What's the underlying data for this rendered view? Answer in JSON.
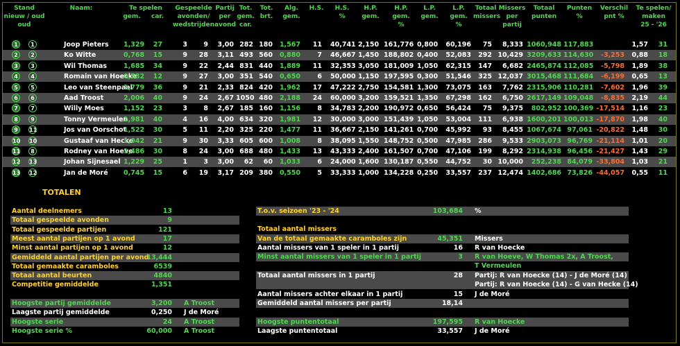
{
  "headers": {
    "stand": "Stand\nnieuw / oud\noud",
    "naam": "Naam:",
    "te_spelen": "Te spelen",
    "te_spelen_gem": "gem.",
    "te_spelen_car": "car.",
    "gespeelde": "Gespeelde\navonden/\nwedstrijden",
    "partij": "Partij\nper\navond",
    "tot_gem_car": "Tot.\ngem.\ncar.",
    "tot_brt": "Tot.\nbrt.",
    "alg_gem": "Alg.\ngem.",
    "hs": "H.S.",
    "hs_pct": "H.S.\n%",
    "hp_gem": "H.P.\ngem.",
    "hp_pct": "H.P.\ngem.\n%",
    "lp_gem": "L.P.\ngem.",
    "lp_pct": "L.P.\ngem.\n%",
    "totaal_missers": "Totaal\nmissers",
    "missers_per_partij": "Missers\nper\npartij",
    "totaal_punten": "Totaal\npunten",
    "punten_pct": "Punten\n%",
    "verschil": "Verschil\npnt %",
    "te_spelen_maken": "Te spelen/\nmaken\n25 - '26"
  },
  "players": [
    {
      "nieuw": "1",
      "oud": "1",
      "naam": "Joop Pieters",
      "gem": "1,329",
      "car": "27",
      "av": "3",
      "wed": "9",
      "ppa": "3,00",
      "totcar": "282",
      "brt": "180",
      "alg": "1,567",
      "hs": "11",
      "hspct": "40,741",
      "hpgem": "2,150",
      "hppct": "161,776",
      "lpgem": "0,800",
      "lppct": "60,196",
      "miss": "75",
      "mpp": "8,333",
      "punten": "1060,948",
      "pct": "117,883",
      "versch": "",
      "ts1": "1,57",
      "ts2": "31"
    },
    {
      "nieuw": "2",
      "oud": "2",
      "naam": "Ko Witte",
      "gem": "0,768",
      "car": "15",
      "av": "9",
      "wed": "28",
      "ppa": "3,11",
      "totcar": "493",
      "brt": "560",
      "alg": "0,880",
      "hs": "7",
      "hspct": "46,667",
      "hpgem": "1,450",
      "hppct": "188,802",
      "lpgem": "0,400",
      "lppct": "52,083",
      "miss": "292",
      "mpp": "10,429",
      "punten": "3209,633",
      "pct": "114,630",
      "versch": "-3,253",
      "ts1": "0,88",
      "ts2": "18"
    },
    {
      "nieuw": "3",
      "oud": "3",
      "naam": "Wil Thomas",
      "gem": "1,685",
      "car": "34",
      "av": "9",
      "wed": "22",
      "ppa": "2,44",
      "totcar": "831",
      "brt": "440",
      "alg": "1,889",
      "hs": "11",
      "hspct": "32,353",
      "hpgem": "3,050",
      "hppct": "181,009",
      "lpgem": "1,050",
      "lppct": "62,315",
      "miss": "147",
      "mpp": "6,682",
      "punten": "2465,874",
      "pct": "112,085",
      "versch": "-5,798",
      "ts1": "1,89",
      "ts2": "38"
    },
    {
      "nieuw": "4",
      "oud": "4",
      "naam": "Romain van Hoecke",
      "gem": "0,582",
      "car": "12",
      "av": "9",
      "wed": "27",
      "ppa": "3,00",
      "totcar": "351",
      "brt": "540",
      "alg": "0,650",
      "hs": "6",
      "hspct": "50,000",
      "hpgem": "1,150",
      "hppct": "197,595",
      "lpgem": "0,300",
      "lppct": "51,546",
      "miss": "325",
      "mpp": "12,037",
      "punten": "3015,468",
      "pct": "111,684",
      "versch": "-6,199",
      "ts1": "0,65",
      "ts2": "13"
    },
    {
      "nieuw": "5",
      "oud": "5",
      "naam": "Leo van Steenpaal",
      "gem": "1,779",
      "car": "36",
      "av": "9",
      "wed": "21",
      "ppa": "2,33",
      "totcar": "824",
      "brt": "420",
      "alg": "1,962",
      "hs": "17",
      "hspct": "47,222",
      "hpgem": "2,750",
      "hppct": "154,581",
      "lpgem": "1,300",
      "lppct": "73,075",
      "miss": "163",
      "mpp": "7,762",
      "punten": "2315,906",
      "pct": "110,281",
      "versch": "-7,602",
      "ts1": "1,96",
      "ts2": "39"
    },
    {
      "nieuw": "6",
      "oud": "6",
      "naam": "Aad Troost",
      "gem": "2,006",
      "car": "40",
      "av": "9",
      "wed": "24",
      "ppa": "2,67",
      "totcar": "1050",
      "brt": "480",
      "alg": "2,188",
      "hs": "24",
      "hspct": "60,000",
      "hpgem": "3,200",
      "hppct": "159,521",
      "lpgem": "1,350",
      "lppct": "67,298",
      "miss": "162",
      "mpp": "6,750",
      "punten": "2617,149",
      "pct": "109,048",
      "versch": "-8,835",
      "ts1": "2,19",
      "ts2": "44"
    },
    {
      "nieuw": "7",
      "oud": "7",
      "naam": "Willy Moes",
      "gem": "1,152",
      "car": "23",
      "av": "3",
      "wed": "8",
      "ppa": "2,67",
      "totcar": "185",
      "brt": "160",
      "alg": "1,156",
      "hs": "8",
      "hspct": "34,783",
      "hpgem": "2,200",
      "hppct": "190,972",
      "lpgem": "0,650",
      "lppct": "56,424",
      "miss": "75",
      "mpp": "9,375",
      "punten": "802,952",
      "pct": "100,369",
      "versch": "-17,514",
      "ts1": "1,16",
      "ts2": "23"
    },
    {
      "nieuw": "8",
      "oud": "9",
      "naam": "Tonny Vermeulen",
      "gem": "1,981",
      "car": "40",
      "av": "4",
      "wed": "16",
      "ppa": "4,00",
      "totcar": "634",
      "brt": "320",
      "alg": "1,981",
      "hs": "12",
      "hspct": "30,000",
      "hpgem": "3,000",
      "hppct": "151,439",
      "lpgem": "1,050",
      "lppct": "53,004",
      "miss": "111",
      "mpp": "6,938",
      "punten": "1600,201",
      "pct": "100,013",
      "versch": "-17,870",
      "ts1": "1,98",
      "ts2": "40"
    },
    {
      "nieuw": "9",
      "oud": "11",
      "naam": "Jos van Oorschot",
      "gem": "1,522",
      "car": "30",
      "av": "5",
      "wed": "11",
      "ppa": "2,20",
      "totcar": "325",
      "brt": "220",
      "alg": "1,477",
      "hs": "11",
      "hspct": "36,667",
      "hpgem": "2,150",
      "hppct": "141,261",
      "lpgem": "0,700",
      "lppct": "45,992",
      "miss": "93",
      "mpp": "8,455",
      "punten": "1067,674",
      "pct": "97,061",
      "versch": "-20,822",
      "ts1": "1,48",
      "ts2": "30"
    },
    {
      "nieuw": "10",
      "oud": "10",
      "naam": "Gustaaf van Hecke",
      "gem": "1,042",
      "car": "21",
      "av": "9",
      "wed": "30",
      "ppa": "3,33",
      "totcar": "605",
      "brt": "600",
      "alg": "1,008",
      "hs": "8",
      "hspct": "38,095",
      "hpgem": "1,550",
      "hppct": "148,752",
      "lpgem": "0,500",
      "lppct": "47,985",
      "miss": "286",
      "mpp": "9,533",
      "punten": "2903,073",
      "pct": "96,769",
      "versch": "-21,114",
      "ts1": "1,01",
      "ts2": "20"
    },
    {
      "nieuw": "11",
      "oud": "8",
      "naam": "Rodney van Hoeve",
      "gem": "1,486",
      "car": "30",
      "av": "8",
      "wed": "24",
      "ppa": "3,00",
      "totcar": "688",
      "brt": "480",
      "alg": "1,433",
      "hs": "13",
      "hspct": "43,333",
      "hpgem": "2,400",
      "hppct": "161,507",
      "lpgem": "0,700",
      "lppct": "47,106",
      "miss": "199",
      "mpp": "8,292",
      "punten": "2314,938",
      "pct": "96,456",
      "versch": "-21,427",
      "ts1": "1,43",
      "ts2": "29"
    },
    {
      "nieuw": "12",
      "oud": "13",
      "naam": "Johan Sijnesael",
      "gem": "1,229",
      "car": "25",
      "av": "1",
      "wed": "3",
      "ppa": "3,00",
      "totcar": "62",
      "brt": "60",
      "alg": "1,033",
      "hs": "6",
      "hspct": "24,000",
      "hpgem": "1,600",
      "hppct": "130,187",
      "lpgem": "0,550",
      "lppct": "44,752",
      "miss": "30",
      "mpp": "10,000",
      "punten": "252,238",
      "pct": "84,079",
      "versch": "-33,804",
      "ts1": "1,03",
      "ts2": "21"
    },
    {
      "nieuw": "13",
      "oud": "12",
      "naam": "Jan de Moré",
      "gem": "0,745",
      "car": "15",
      "av": "6",
      "wed": "19",
      "ppa": "3,17",
      "totcar": "209",
      "brt": "380",
      "alg": "0,550",
      "hs": "5",
      "hspct": "33,333",
      "hpgem": "1,000",
      "hppct": "134,228",
      "lpgem": "0,250",
      "lppct": "33,557",
      "miss": "237",
      "mpp": "12,474",
      "punten": "1402,686",
      "pct": "73,826",
      "versch": "-44,057",
      "ts1": "0,55",
      "ts2": "11"
    }
  ],
  "totalen_title": "TOTALEN",
  "left_totals": [
    {
      "label": "Aantal deelnemers",
      "value": "13",
      "extra": "",
      "alt": false,
      "lc": "y"
    },
    {
      "label": "Totaal gespeelde avonden",
      "value": "9",
      "extra": "",
      "alt": true,
      "lc": "y"
    },
    {
      "label": "Totaal gespeelde partijen",
      "value": "121",
      "extra": "",
      "alt": false,
      "lc": "y"
    },
    {
      "label": "Meest aantal partijen op 1 avond",
      "value": "17",
      "extra": "",
      "alt": true,
      "lc": "y"
    },
    {
      "label": "Minst aantal partijen op 1 avond",
      "value": "12",
      "extra": "",
      "alt": false,
      "lc": "y"
    },
    {
      "label": "Gemiddeld aantal partijen per avond",
      "value": "13,444",
      "extra": "",
      "alt": true,
      "lc": "y"
    },
    {
      "label": "Totaal gemaakte caramboles",
      "value": "6539",
      "extra": "",
      "alt": false,
      "lc": "y"
    },
    {
      "label": "Totaal aantal beurten",
      "value": "4840",
      "extra": "",
      "alt": true,
      "lc": "y"
    },
    {
      "label": "Competitie gemiddelde",
      "value": "1,351",
      "extra": "",
      "alt": false,
      "lc": "y"
    }
  ],
  "left_records": [
    {
      "label": "Hoogste partij gemiddelde",
      "value": "3,200",
      "extra": "A Troost",
      "alt": true,
      "lc": "g"
    },
    {
      "label": "Laagste partij gemiddelde",
      "value": "0,250",
      "extra": "J de Moré",
      "alt": false,
      "lc": "w"
    },
    {
      "label": "Hoogste serie",
      "value": "24",
      "extra": "A Troost",
      "alt": true,
      "lc": "g"
    },
    {
      "label": "Hoogste serie %",
      "value": "60,000",
      "extra": "A Troost",
      "alt": false,
      "lc": "g"
    }
  ],
  "right_seizoen": {
    "label": "T.o.v. seizoen '23 - '24",
    "value": "103,684",
    "unit": "%"
  },
  "right_missers_title": "Totaal aantal missers",
  "right_missers": [
    {
      "label": "Van de totaal gemaakte caramboles zijn",
      "value": "45,351",
      "extra": "Missers",
      "alt": true,
      "lc": "y"
    },
    {
      "label": "Aantal missers van 1 speler in 1 partij",
      "value": "16",
      "extra": "R van Hoecke",
      "alt": false,
      "lc": "w"
    },
    {
      "label": "Minst aantal missers van 1 speler in 1 partij",
      "value": "3",
      "extra": "R van Hoeve, W Thomas 2x, A Troost,",
      "alt": true,
      "lc": "g"
    },
    {
      "label": "",
      "value": "",
      "extra": "T Vermeulen",
      "alt": false,
      "lc": "g"
    }
  ],
  "right_partij": [
    {
      "label": "Totaal aantal missers in 1 partij",
      "value": "28",
      "extra": "Partij: R van Hoecke (14) - J de Moré (14)",
      "alt": true,
      "lc": "w"
    },
    {
      "label": "",
      "value": "",
      "extra": "Partij: R van Hoecke (14) - G van Hecke (14)",
      "alt": true,
      "lc": "w"
    },
    {
      "label": "Aantal missers achter elkaar in 1 partij",
      "value": "15",
      "extra": "J de Moré",
      "alt": false,
      "lc": "w"
    },
    {
      "label": "Gemiddeld aantal missers per partij",
      "value": "18,14",
      "extra": "",
      "alt": true,
      "lc": "w"
    }
  ],
  "right_punten": [
    {
      "label": "Hoogste puntentotaal",
      "value": "197,595",
      "extra": "R van Hoecke",
      "alt": true,
      "lc": "g"
    },
    {
      "label": "Laagste puntentotaal",
      "value": "33,557",
      "extra": "J de Moré",
      "alt": false,
      "lc": "w"
    }
  ],
  "colors": {
    "accent": "#4cd84c",
    "title": "#ffd21f",
    "negative": "#ff6b2b",
    "row_alt": "#4a4a4a"
  }
}
